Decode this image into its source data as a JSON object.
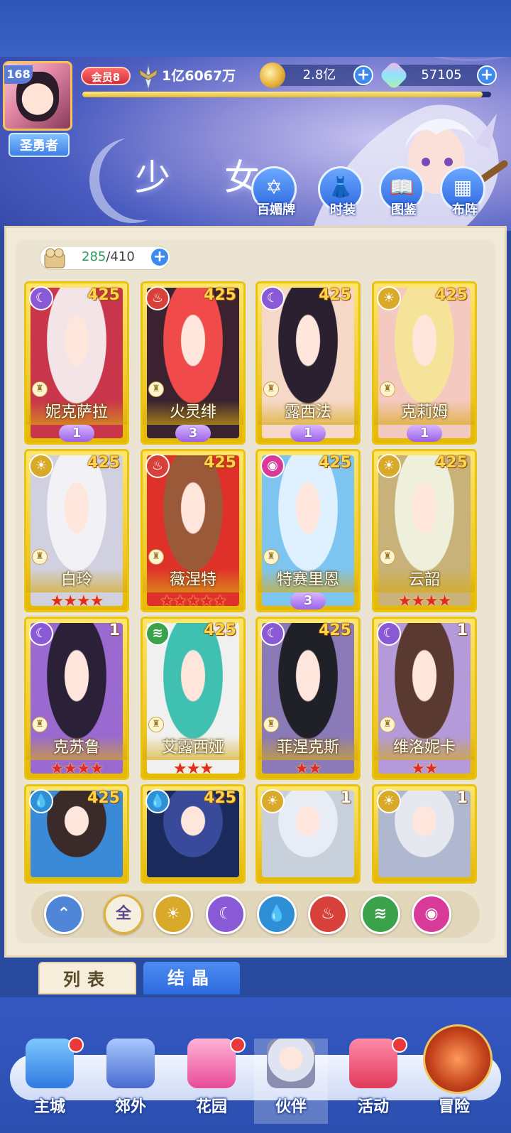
{
  "header": {
    "player_level": "168",
    "title_badge": "圣勇者",
    "vip_label": "会员8",
    "power": "1亿6067万",
    "gold": "2.8亿",
    "gems": "57105",
    "xp_fraction": 0.98
  },
  "section_title": "少 女",
  "menu": [
    {
      "label": "百媚牌",
      "icon": "card-book-icon"
    },
    {
      "label": "时装",
      "icon": "costume-icon"
    },
    {
      "label": "图鉴",
      "icon": "gallery-book-icon"
    },
    {
      "label": "布阵",
      "icon": "formation-grid-icon"
    }
  ],
  "capacity": {
    "current": "285",
    "max": "/410"
  },
  "cards": [
    {
      "name": "妮克萨拉",
      "level": "425",
      "element": "moon",
      "rank": "wing",
      "rank_value": "1"
    },
    {
      "name": "火灵绯",
      "level": "425",
      "element": "fire",
      "rank": "wing",
      "rank_value": "3"
    },
    {
      "name": "露西法",
      "level": "425",
      "element": "moon",
      "rank": "wing",
      "rank_value": "1"
    },
    {
      "name": "克莉姆",
      "level": "425",
      "element": "sun",
      "rank": "wing",
      "rank_value": "1"
    },
    {
      "name": "白玲",
      "level": "425",
      "element": "sun",
      "rank": "stars",
      "stars": "★★★★"
    },
    {
      "name": "薇涅特",
      "level": "425",
      "element": "fire",
      "rank": "stars",
      "stars": "★★★★★"
    },
    {
      "name": "特赛里恩",
      "level": "425",
      "element": "pink",
      "rank": "wing",
      "rank_value": "3"
    },
    {
      "name": "云韶",
      "level": "425",
      "element": "sun",
      "rank": "stars",
      "stars": "★★★★"
    },
    {
      "name": "克苏鲁",
      "level": "1",
      "element": "moon",
      "rank": "stars",
      "stars": "★★★★"
    },
    {
      "name": "艾露西娅",
      "level": "425",
      "element": "wind",
      "rank": "stars",
      "stars": "★★★"
    },
    {
      "name": "菲涅克斯",
      "level": "425",
      "element": "moon",
      "rank": "stars",
      "stars": "★★"
    },
    {
      "name": "维洛妮卡",
      "level": "1",
      "element": "moon",
      "rank": "stars",
      "stars": "★★"
    },
    {
      "name": "",
      "level": "425",
      "element": "water",
      "rank": "none"
    },
    {
      "name": "",
      "level": "425",
      "element": "water",
      "rank": "none"
    },
    {
      "name": "",
      "level": "1",
      "element": "sun",
      "rank": "none"
    },
    {
      "name": "",
      "level": "1",
      "element": "sun",
      "rank": "none"
    }
  ],
  "filters": [
    {
      "key": "sort",
      "label": "",
      "color": "#4f86d8",
      "glyph": "⌃"
    },
    {
      "key": "all",
      "label": "全",
      "color": "#f5efe0",
      "glyph": "全"
    },
    {
      "key": "sun",
      "label": "",
      "color": "#d9a92a",
      "glyph": "☀"
    },
    {
      "key": "moon",
      "label": "",
      "color": "#8a5ad6",
      "glyph": "☾"
    },
    {
      "key": "water",
      "label": "",
      "color": "#2f8fd6",
      "glyph": "💧"
    },
    {
      "key": "fire",
      "label": "",
      "color": "#d8403a",
      "glyph": "♨"
    },
    {
      "key": "wind",
      "label": "",
      "color": "#3aa24a",
      "glyph": "≋"
    },
    {
      "key": "pink",
      "label": "",
      "color": "#d83a9a",
      "glyph": "◉"
    }
  ],
  "tabs": {
    "list": "列表",
    "crystal": "结晶"
  },
  "nav": [
    {
      "label": "主城",
      "dot": true
    },
    {
      "label": "郊外",
      "dot": false
    },
    {
      "label": "花园",
      "dot": true
    },
    {
      "label": "伙伴",
      "dot": false
    },
    {
      "label": "活动",
      "dot": true
    },
    {
      "label": "冒险",
      "dot": false
    }
  ],
  "colors": {
    "sun": "#d9a92a",
    "moon": "#8a5ad6",
    "fire": "#d8403a",
    "water": "#2f8fd6",
    "wind": "#3aa24a",
    "pink": "#d83a9a"
  }
}
